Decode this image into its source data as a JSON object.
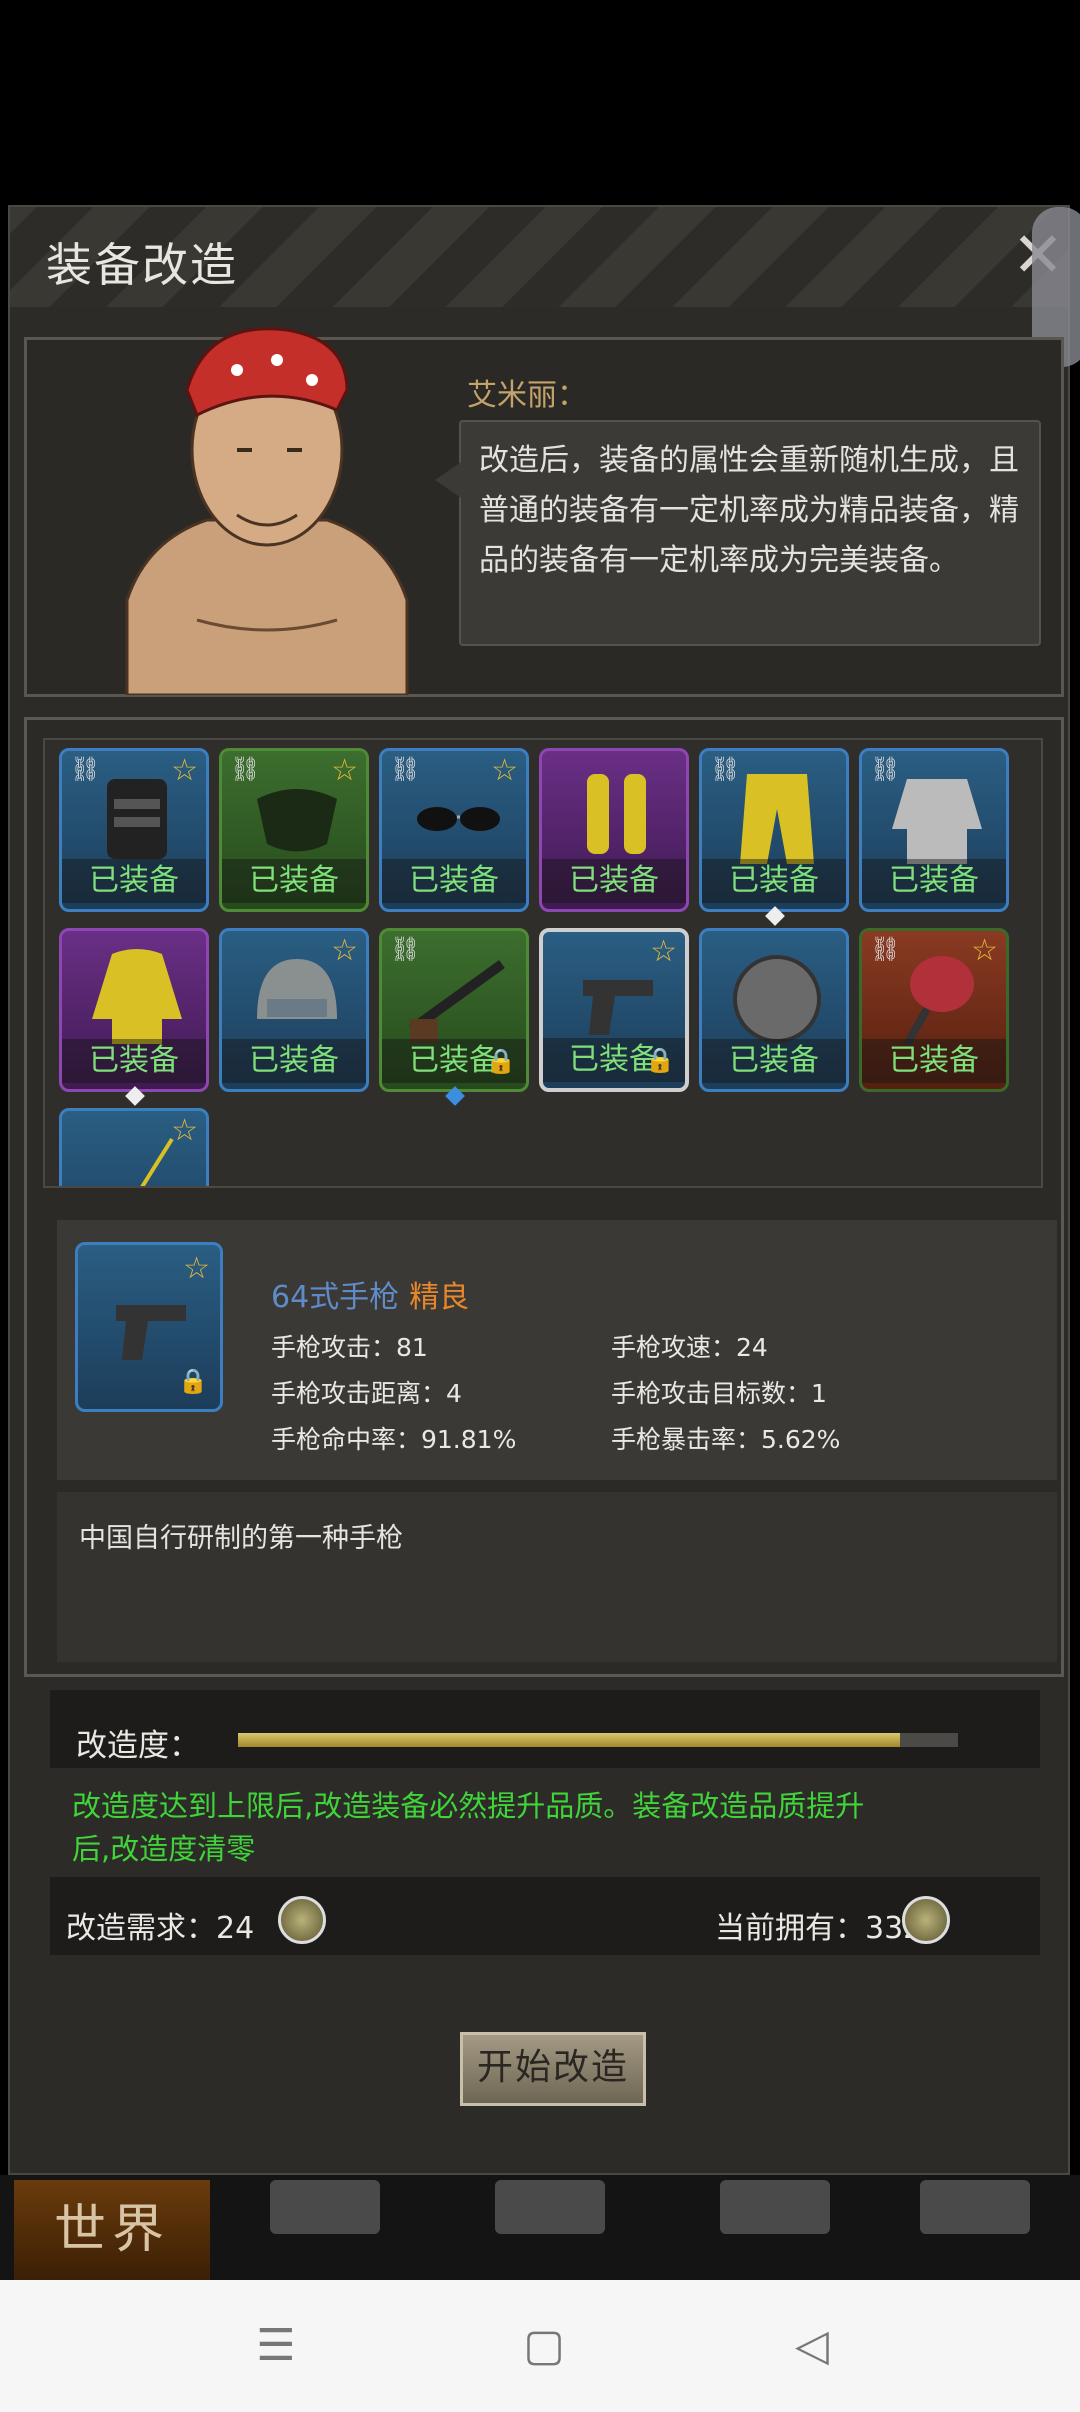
{
  "dialog": {
    "title": "装备改造",
    "close_symbol": "✕"
  },
  "npc": {
    "name": "艾米丽：",
    "speech": "改造后，装备的属性会重新随机生成，且普通的装备有一定机率成为精品装备，精品的装备有一定机率成为完美装备。"
  },
  "equipment": {
    "equipped_label": "已装备",
    "slots": [
      {
        "icon": "tactical-vest-icon",
        "color": "blue"
      },
      {
        "icon": "mask-icon",
        "color": "green"
      },
      {
        "icon": "sunglasses-icon",
        "color": "blue"
      },
      {
        "icon": "boots-icon",
        "color": "purple"
      },
      {
        "icon": "pants-icon",
        "color": "blue"
      },
      {
        "icon": "shirt-icon",
        "color": "blue"
      },
      {
        "icon": "jacket-icon",
        "color": "purple"
      },
      {
        "icon": "helmet-icon",
        "color": "blue"
      },
      {
        "icon": "shotgun-icon",
        "color": "green"
      },
      {
        "icon": "pistol-icon",
        "color": "blue"
      },
      {
        "icon": "shield-icon",
        "color": "blue"
      },
      {
        "icon": "pan-icon",
        "color": "red"
      },
      {
        "icon": "stick-icon",
        "color": "blue"
      }
    ]
  },
  "item": {
    "name": "64式手枪",
    "quality": "精良",
    "stats": {
      "attack": "手枪攻击：81",
      "speed": "手枪攻速：24",
      "range": "手枪攻击距离：4",
      "targets": "手枪攻击目标数：1",
      "hit_rate": "手枪命中率：91.81%",
      "crit_rate": "手枪暴击率：5.62%"
    },
    "description": "中国自行研制的第一种手枪"
  },
  "refine": {
    "label": "改造度：",
    "progress": 0.92,
    "note": "改造度达到上限后,改造装备必然提升品质。装备改造品质提升后,改造度清零",
    "cost_label": "改造需求：24",
    "owned_label": "当前拥有：332",
    "start_button": "开始改造"
  },
  "game_nav": {
    "world": "世界"
  },
  "colors": {
    "accent_green": "#40d43a",
    "quality_orange": "#e8862b",
    "item_blue": "#5f8cc8"
  }
}
